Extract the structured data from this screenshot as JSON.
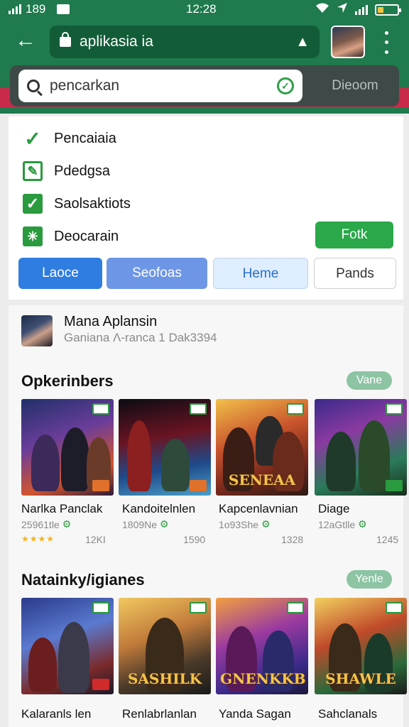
{
  "status_bar": {
    "left": "189",
    "time": "12:28"
  },
  "address_bar": {
    "url": "aplikasia ia"
  },
  "search": {
    "value": "pencarkan",
    "action_label": "Dieoom"
  },
  "filter_options": [
    {
      "label": "Pencaiaia",
      "icon": "check-icon"
    },
    {
      "label": "Pdedgsa",
      "icon": "edit-icon"
    },
    {
      "label": "Saolsaktiots",
      "icon": "checkbox-icon"
    },
    {
      "label": "Deocarain",
      "icon": "grid-icon"
    }
  ],
  "fork_button": "Fotk",
  "tabs": [
    "Laoce",
    "Seofoas",
    "Heme",
    "Pands"
  ],
  "profile": {
    "name": "Mana Aplansin",
    "subtitle": "Ganiana  Λ-ranca 1  Dak3394"
  },
  "sections": [
    {
      "title": "Opkerinbers",
      "pill": "Vane",
      "cards": [
        {
          "title": "Narlka Panclak",
          "meta": "25961tle",
          "rating": "★★★★",
          "downloads": "12KI",
          "art": ""
        },
        {
          "title": "Kandoitelnlen",
          "meta": "1809Ne",
          "rating": "",
          "downloads": "1590",
          "art": ""
        },
        {
          "title": "Kapcenlavnian",
          "meta": "1o93She",
          "rating": "",
          "downloads": "1328",
          "art": "SENEAA"
        },
        {
          "title": "Diage",
          "meta": "12aGtlle",
          "rating": "",
          "downloads": "1245",
          "art": ""
        }
      ]
    },
    {
      "title": "Natainky/igianes",
      "pill": "Yenle",
      "cards": [
        {
          "title": "Kalaranls len",
          "art": ""
        },
        {
          "title": "Renlabrlanlan",
          "art": "SASHILK"
        },
        {
          "title": "Yanda Sagan",
          "art": "GNENKKB"
        },
        {
          "title": "Sahclanals",
          "art": "SHAWLE"
        }
      ]
    }
  ],
  "colors": {
    "brand_green": "#1f7a4d",
    "accent_red": "#c92a4a",
    "action_green": "#2aa84a",
    "primary_blue": "#2f7de0"
  }
}
